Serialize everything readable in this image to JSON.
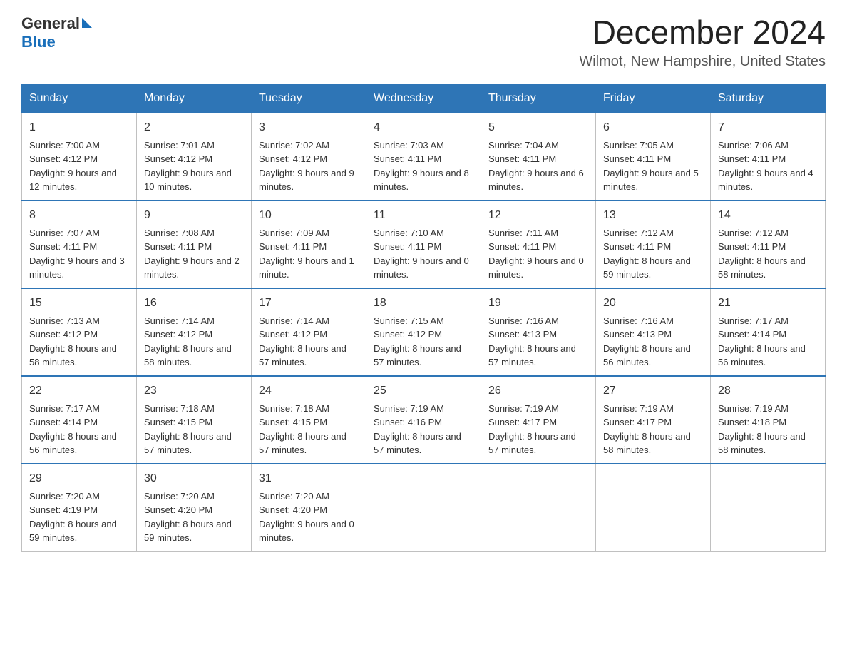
{
  "header": {
    "logo_general": "General",
    "logo_blue": "Blue",
    "title": "December 2024",
    "subtitle": "Wilmot, New Hampshire, United States"
  },
  "days_of_week": [
    "Sunday",
    "Monday",
    "Tuesday",
    "Wednesday",
    "Thursday",
    "Friday",
    "Saturday"
  ],
  "weeks": [
    [
      {
        "day": "1",
        "sunrise": "7:00 AM",
        "sunset": "4:12 PM",
        "daylight": "9 hours and 12 minutes."
      },
      {
        "day": "2",
        "sunrise": "7:01 AM",
        "sunset": "4:12 PM",
        "daylight": "9 hours and 10 minutes."
      },
      {
        "day": "3",
        "sunrise": "7:02 AM",
        "sunset": "4:12 PM",
        "daylight": "9 hours and 9 minutes."
      },
      {
        "day": "4",
        "sunrise": "7:03 AM",
        "sunset": "4:11 PM",
        "daylight": "9 hours and 8 minutes."
      },
      {
        "day": "5",
        "sunrise": "7:04 AM",
        "sunset": "4:11 PM",
        "daylight": "9 hours and 6 minutes."
      },
      {
        "day": "6",
        "sunrise": "7:05 AM",
        "sunset": "4:11 PM",
        "daylight": "9 hours and 5 minutes."
      },
      {
        "day": "7",
        "sunrise": "7:06 AM",
        "sunset": "4:11 PM",
        "daylight": "9 hours and 4 minutes."
      }
    ],
    [
      {
        "day": "8",
        "sunrise": "7:07 AM",
        "sunset": "4:11 PM",
        "daylight": "9 hours and 3 minutes."
      },
      {
        "day": "9",
        "sunrise": "7:08 AM",
        "sunset": "4:11 PM",
        "daylight": "9 hours and 2 minutes."
      },
      {
        "day": "10",
        "sunrise": "7:09 AM",
        "sunset": "4:11 PM",
        "daylight": "9 hours and 1 minute."
      },
      {
        "day": "11",
        "sunrise": "7:10 AM",
        "sunset": "4:11 PM",
        "daylight": "9 hours and 0 minutes."
      },
      {
        "day": "12",
        "sunrise": "7:11 AM",
        "sunset": "4:11 PM",
        "daylight": "9 hours and 0 minutes."
      },
      {
        "day": "13",
        "sunrise": "7:12 AM",
        "sunset": "4:11 PM",
        "daylight": "8 hours and 59 minutes."
      },
      {
        "day": "14",
        "sunrise": "7:12 AM",
        "sunset": "4:11 PM",
        "daylight": "8 hours and 58 minutes."
      }
    ],
    [
      {
        "day": "15",
        "sunrise": "7:13 AM",
        "sunset": "4:12 PM",
        "daylight": "8 hours and 58 minutes."
      },
      {
        "day": "16",
        "sunrise": "7:14 AM",
        "sunset": "4:12 PM",
        "daylight": "8 hours and 58 minutes."
      },
      {
        "day": "17",
        "sunrise": "7:14 AM",
        "sunset": "4:12 PM",
        "daylight": "8 hours and 57 minutes."
      },
      {
        "day": "18",
        "sunrise": "7:15 AM",
        "sunset": "4:12 PM",
        "daylight": "8 hours and 57 minutes."
      },
      {
        "day": "19",
        "sunrise": "7:16 AM",
        "sunset": "4:13 PM",
        "daylight": "8 hours and 57 minutes."
      },
      {
        "day": "20",
        "sunrise": "7:16 AM",
        "sunset": "4:13 PM",
        "daylight": "8 hours and 56 minutes."
      },
      {
        "day": "21",
        "sunrise": "7:17 AM",
        "sunset": "4:14 PM",
        "daylight": "8 hours and 56 minutes."
      }
    ],
    [
      {
        "day": "22",
        "sunrise": "7:17 AM",
        "sunset": "4:14 PM",
        "daylight": "8 hours and 56 minutes."
      },
      {
        "day": "23",
        "sunrise": "7:18 AM",
        "sunset": "4:15 PM",
        "daylight": "8 hours and 57 minutes."
      },
      {
        "day": "24",
        "sunrise": "7:18 AM",
        "sunset": "4:15 PM",
        "daylight": "8 hours and 57 minutes."
      },
      {
        "day": "25",
        "sunrise": "7:19 AM",
        "sunset": "4:16 PM",
        "daylight": "8 hours and 57 minutes."
      },
      {
        "day": "26",
        "sunrise": "7:19 AM",
        "sunset": "4:17 PM",
        "daylight": "8 hours and 57 minutes."
      },
      {
        "day": "27",
        "sunrise": "7:19 AM",
        "sunset": "4:17 PM",
        "daylight": "8 hours and 58 minutes."
      },
      {
        "day": "28",
        "sunrise": "7:19 AM",
        "sunset": "4:18 PM",
        "daylight": "8 hours and 58 minutes."
      }
    ],
    [
      {
        "day": "29",
        "sunrise": "7:20 AM",
        "sunset": "4:19 PM",
        "daylight": "8 hours and 59 minutes."
      },
      {
        "day": "30",
        "sunrise": "7:20 AM",
        "sunset": "4:20 PM",
        "daylight": "8 hours and 59 minutes."
      },
      {
        "day": "31",
        "sunrise": "7:20 AM",
        "sunset": "4:20 PM",
        "daylight": "9 hours and 0 minutes."
      },
      null,
      null,
      null,
      null
    ]
  ],
  "labels": {
    "sunrise": "Sunrise:",
    "sunset": "Sunset:",
    "daylight": "Daylight:"
  }
}
